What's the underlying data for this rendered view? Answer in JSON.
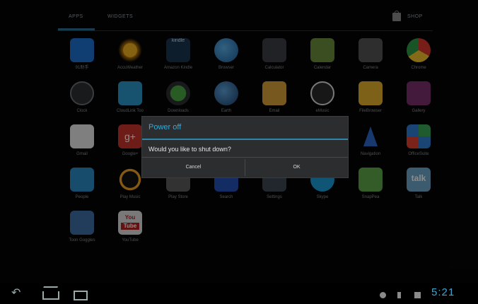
{
  "tabs": {
    "apps": "APPS",
    "widgets": "WIDGETS",
    "shop": "SHOP"
  },
  "apps": [
    {
      "label": "91助手"
    },
    {
      "label": "AccuWeather"
    },
    {
      "label": "Amazon Kindle"
    },
    {
      "label": "Browser"
    },
    {
      "label": "Calculator"
    },
    {
      "label": "Calendar"
    },
    {
      "label": "Camera"
    },
    {
      "label": "Chrome"
    },
    {
      "label": "Clock"
    },
    {
      "label": "CloudLink Too"
    },
    {
      "label": "Downloads"
    },
    {
      "label": "Earth"
    },
    {
      "label": "Email"
    },
    {
      "label": "eMusic"
    },
    {
      "label": "FileBrowser"
    },
    {
      "label": "Gallery"
    },
    {
      "label": "Gmail"
    },
    {
      "label": "Google+"
    },
    {
      "label": ""
    },
    {
      "label": ""
    },
    {
      "label": ""
    },
    {
      "label": ""
    },
    {
      "label": "Navigation"
    },
    {
      "label": "OfficeSuite"
    },
    {
      "label": "People"
    },
    {
      "label": "Play Music"
    },
    {
      "label": "Play Store"
    },
    {
      "label": "Search"
    },
    {
      "label": "Settings"
    },
    {
      "label": "Skype"
    },
    {
      "label": "SnapPea"
    },
    {
      "label": "Talk"
    },
    {
      "label": "Toon Goggles"
    },
    {
      "label": "YouTube"
    }
  ],
  "icon_text": {
    "kindle": "kindle",
    "gplus": "g+",
    "talk": "talk",
    "youtube_top": "You",
    "youtube_bottom": "Tube"
  },
  "dialog": {
    "title": "Power off",
    "message": "Would you like to shut down?",
    "cancel": "Cancel",
    "ok": "OK"
  },
  "status": {
    "time": "5:21"
  },
  "colors": {
    "accent": "#38a9d6",
    "dialog_bg": "#2b2d2f"
  }
}
